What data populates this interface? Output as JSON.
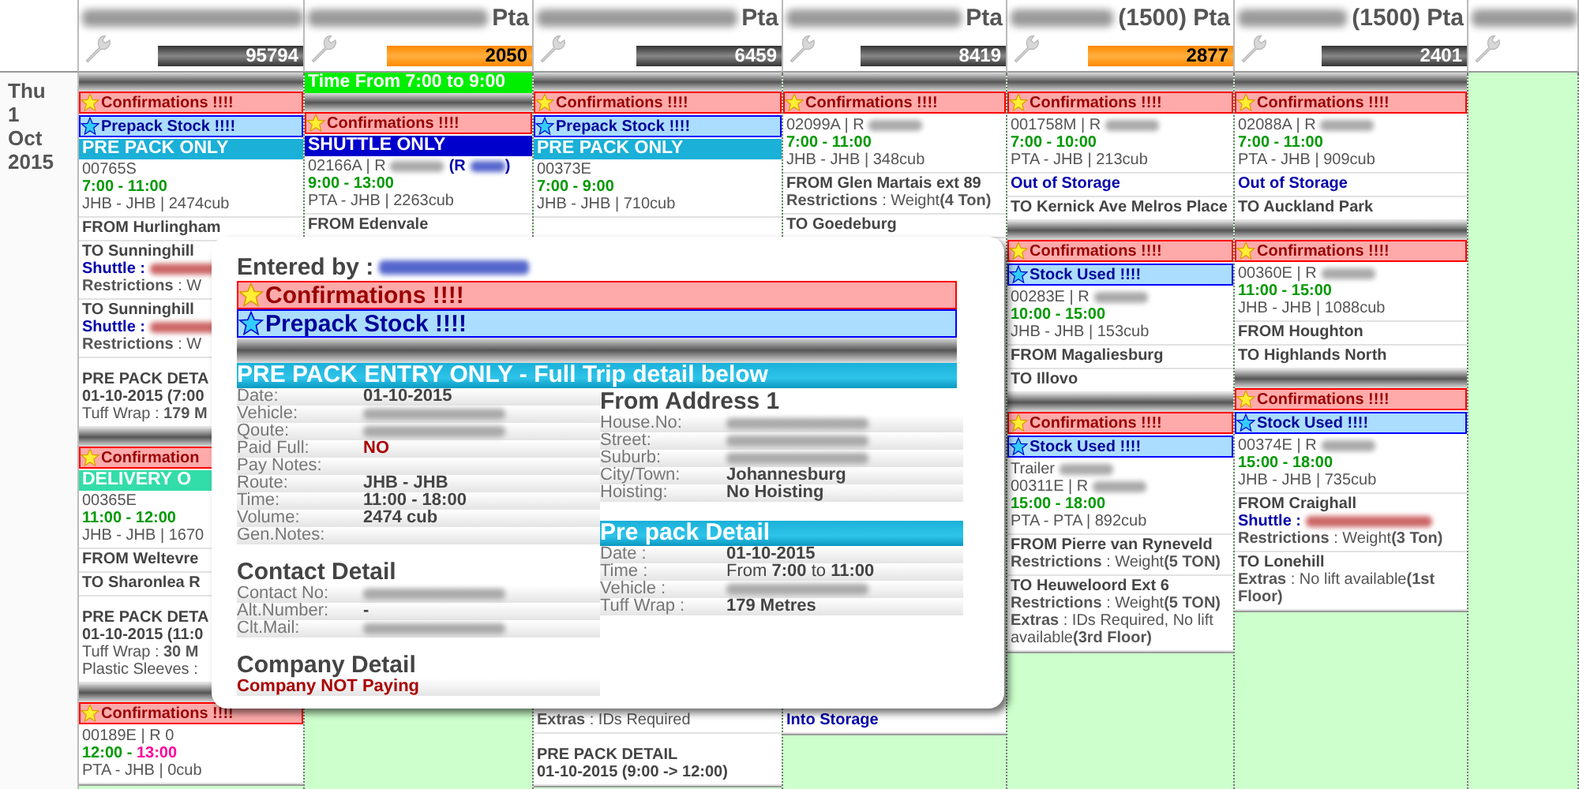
{
  "date": {
    "weekday": "Thu",
    "day": "1",
    "month": "Oct",
    "year": "2015"
  },
  "columns": [
    {
      "header": {
        "count": "95794",
        "highlight": false
      },
      "items": [
        {
          "kind": "redacted"
        },
        {
          "kind": "confirm",
          "text": "Confirmations !!!!"
        },
        {
          "kind": "stock",
          "text": "Prepack Stock !!!!"
        },
        {
          "kind": "band",
          "text": "PRE PACK ONLY",
          "color": "#1ab0d8"
        },
        {
          "kind": "section",
          "lines": [
            {
              "kind": "plain",
              "text": "00765S"
            },
            {
              "kind": "time",
              "text": "7:00 - 11:00"
            },
            {
              "kind": "plain",
              "text": "JHB - JHB | 2474cub"
            }
          ]
        },
        {
          "kind": "section",
          "lines": [
            {
              "kind": "place",
              "text": "FROM Hurlingham"
            }
          ]
        },
        {
          "kind": "section",
          "lines": [
            {
              "kind": "place",
              "text": "TO Sunninghill"
            },
            {
              "kind": "shuttle",
              "text": "Shuttle :"
            },
            {
              "kind": "detail",
              "text": "**Restrictions** : W"
            }
          ]
        },
        {
          "kind": "section",
          "lines": [
            {
              "kind": "place",
              "text": "TO Sunninghill"
            },
            {
              "kind": "shuttle",
              "text": "Shuttle :"
            },
            {
              "kind": "detail",
              "text": "**Restrictions** : W"
            }
          ]
        },
        {
          "kind": "section",
          "lines": [
            {
              "kind": "heading",
              "text": "PRE PACK DETA"
            },
            {
              "kind": "place",
              "text": "01-10-2015 (7:00"
            },
            {
              "kind": "detail",
              "text": "Tuff Wrap : **179 M**"
            }
          ]
        },
        {
          "kind": "redacted"
        },
        {
          "kind": "confirm",
          "text": "Confirmation"
        },
        {
          "kind": "band",
          "text": "DELIVERY O",
          "color": "#33ddaa"
        },
        {
          "kind": "section",
          "lines": [
            {
              "kind": "plain",
              "text": "00365E"
            },
            {
              "kind": "time",
              "text": "11:00 - 12:00"
            },
            {
              "kind": "plain",
              "text": "JHB - JHB | 1670"
            }
          ]
        },
        {
          "kind": "section",
          "lines": [
            {
              "kind": "place",
              "text": "FROM Weltevre"
            }
          ]
        },
        {
          "kind": "section",
          "lines": [
            {
              "kind": "place",
              "text": "TO Sharonlea R"
            }
          ]
        },
        {
          "kind": "section",
          "lines": [
            {
              "kind": "heading",
              "text": "PRE PACK DETA"
            },
            {
              "kind": "place",
              "text": "01-10-2015 (11:0"
            },
            {
              "kind": "detail",
              "text": "Tuff Wrap : **30 M**"
            },
            {
              "kind": "plain",
              "text": "Plastic Sleeves :"
            }
          ]
        },
        {
          "kind": "redacted"
        },
        {
          "kind": "confirm",
          "text": "Confirmations !!!!"
        },
        {
          "kind": "section",
          "lines": [
            {
              "kind": "plain",
              "text": "00189E | R 0"
            },
            {
              "kind": "time",
              "text": "12:00 - ",
              "late": "13:00"
            },
            {
              "kind": "plain",
              "text": "PTA - JHB | 0cub"
            }
          ]
        }
      ]
    },
    {
      "header": {
        "suffix": "Pta",
        "count": "2050",
        "highlight": true
      },
      "items": [
        {
          "kind": "band",
          "text": "Time From 7:00 to 9:00",
          "color": "#00ee00"
        },
        {
          "kind": "redacted"
        },
        {
          "kind": "confirm",
          "text": "Confirmations !!!!"
        },
        {
          "kind": "band",
          "text": "SHUTTLE ONLY",
          "color": "#0000cc"
        },
        {
          "kind": "section",
          "lines": [
            {
              "kind": "plain",
              "text": "02166A | R",
              "redacted": true,
              "extra": "(R",
              "tail": ")"
            },
            {
              "kind": "time",
              "text": "9:00 - 13:00"
            },
            {
              "kind": "plain",
              "text": "PTA - JHB | 2263cub"
            }
          ]
        },
        {
          "kind": "section",
          "lines": [
            {
              "kind": "place",
              "text": "FROM Edenvale"
            }
          ]
        }
      ]
    },
    {
      "header": {
        "suffix": "Pta",
        "count": "6459",
        "highlight": false
      },
      "items": [
        {
          "kind": "redacted"
        },
        {
          "kind": "confirm",
          "text": "Confirmations !!!!"
        },
        {
          "kind": "stock",
          "text": "Prepack Stock !!!!"
        },
        {
          "kind": "band",
          "text": "PRE PACK ONLY",
          "color": "#1ab0d8"
        },
        {
          "kind": "section",
          "lines": [
            {
              "kind": "plain",
              "text": "00373E"
            },
            {
              "kind": "time",
              "text": "7:00 - 9:00"
            },
            {
              "kind": "plain",
              "text": "JHB - JHB | 710cub"
            }
          ]
        }
      ],
      "below": [
        {
          "kind": "section",
          "lines": [
            {
              "kind": "detail",
              "text": "**Extras** : IDs Required"
            }
          ]
        },
        {
          "kind": "section",
          "lines": [
            {
              "kind": "heading",
              "text": "PRE PACK DETAIL"
            },
            {
              "kind": "place",
              "text": "01-10-2015 (9:00 -> 12:00)"
            }
          ]
        }
      ]
    },
    {
      "header": {
        "suffix": "Pta",
        "count": "8419",
        "highlight": false
      },
      "items": [
        {
          "kind": "redacted"
        },
        {
          "kind": "confirm",
          "text": "Confirmations !!!!"
        },
        {
          "kind": "section",
          "lines": [
            {
              "kind": "plain",
              "text": "02099A | R",
              "redacted": true
            },
            {
              "kind": "time",
              "text": "7:00 - 11:00"
            },
            {
              "kind": "plain",
              "text": "JHB - JHB | 348cub"
            }
          ]
        },
        {
          "kind": "section",
          "lines": [
            {
              "kind": "place",
              "text": "FROM Glen Martais ext 89"
            },
            {
              "kind": "detail",
              "text": "**Restrictions** : Weight**(4 Ton)**"
            }
          ]
        },
        {
          "kind": "section",
          "lines": [
            {
              "kind": "place",
              "text": "TO Goedeburg"
            }
          ]
        }
      ],
      "below": [
        {
          "kind": "section",
          "lines": [
            {
              "kind": "storage",
              "text": "Into Storage"
            }
          ]
        }
      ]
    },
    {
      "header": {
        "suffix": "(1500) Pta",
        "count": "2877",
        "highlight": true
      },
      "items": [
        {
          "kind": "redacted"
        },
        {
          "kind": "confirm",
          "text": "Confirmations !!!!"
        },
        {
          "kind": "section",
          "lines": [
            {
              "kind": "plain",
              "text": "001758M | R",
              "redacted": true
            },
            {
              "kind": "time",
              "text": "7:00 - 10:00"
            },
            {
              "kind": "plain",
              "text": "PTA - JHB | 213cub"
            }
          ]
        },
        {
          "kind": "section",
          "lines": [
            {
              "kind": "storage",
              "text": "Out of Storage"
            }
          ]
        },
        {
          "kind": "section",
          "lines": [
            {
              "kind": "place",
              "text": "TO Kernick Ave Melros Place"
            }
          ]
        },
        {
          "kind": "redacted"
        },
        {
          "kind": "confirm",
          "text": "Confirmations !!!!"
        },
        {
          "kind": "stock",
          "text": "Stock Used !!!!"
        },
        {
          "kind": "section",
          "lines": [
            {
              "kind": "plain",
              "text": "00283E | R",
              "redacted": true
            },
            {
              "kind": "time",
              "text": "10:00 - 15:00"
            },
            {
              "kind": "plain",
              "text": "JHB - JHB | 153cub"
            }
          ]
        },
        {
          "kind": "section",
          "lines": [
            {
              "kind": "place",
              "text": "FROM Magaliesburg"
            }
          ]
        },
        {
          "kind": "section",
          "lines": [
            {
              "kind": "place",
              "text": "TO Illovo"
            }
          ]
        },
        {
          "kind": "redacted"
        },
        {
          "kind": "confirm",
          "text": "Confirmations !!!!"
        },
        {
          "kind": "stock",
          "text": "Stock Used !!!!"
        },
        {
          "kind": "section",
          "lines": [
            {
              "kind": "plain",
              "text": "Trailer",
              "redacted": true
            },
            {
              "kind": "plain",
              "text": "00311E | R",
              "redacted": true
            },
            {
              "kind": "time",
              "text": "15:00 - 18:00"
            },
            {
              "kind": "plain",
              "text": "PTA - PTA | 892cub"
            }
          ]
        },
        {
          "kind": "section",
          "lines": [
            {
              "kind": "place",
              "text": "FROM Pierre van Ryneveld"
            },
            {
              "kind": "detail",
              "text": "**Restrictions** : Weight**(5 TON)**"
            }
          ]
        },
        {
          "kind": "section",
          "lines": [
            {
              "kind": "place",
              "text": "TO Heuweloord Ext 6"
            },
            {
              "kind": "detail",
              "text": "**Restrictions** : Weight**(5 TON)**"
            },
            {
              "kind": "detail",
              "text": "**Extras** : IDs Required, No lift available**(3rd Floor)**"
            }
          ]
        }
      ]
    },
    {
      "header": {
        "suffix": "(1500) Pta",
        "count": "2401",
        "highlight": false
      },
      "items": [
        {
          "kind": "redacted"
        },
        {
          "kind": "confirm",
          "text": "Confirmations !!!!"
        },
        {
          "kind": "section",
          "lines": [
            {
              "kind": "plain",
              "text": "02088A | R",
              "redacted": true
            },
            {
              "kind": "time",
              "text": "7:00 - 11:00"
            },
            {
              "kind": "plain",
              "text": "PTA - JHB | 909cub"
            }
          ]
        },
        {
          "kind": "section",
          "lines": [
            {
              "kind": "storage",
              "text": "Out of Storage"
            }
          ]
        },
        {
          "kind": "section",
          "lines": [
            {
              "kind": "place",
              "text": "TO Auckland Park"
            }
          ]
        },
        {
          "kind": "redacted"
        },
        {
          "kind": "confirm",
          "text": "Confirmations !!!!"
        },
        {
          "kind": "section",
          "lines": [
            {
              "kind": "plain",
              "text": "00360E | R",
              "redacted": true
            },
            {
              "kind": "time",
              "text": "11:00 - 15:00"
            },
            {
              "kind": "plain",
              "text": "JHB - JHB | 1088cub"
            }
          ]
        },
        {
          "kind": "section",
          "lines": [
            {
              "kind": "place",
              "text": "FROM Houghton"
            }
          ]
        },
        {
          "kind": "section",
          "lines": [
            {
              "kind": "place",
              "text": "TO Highlands North"
            }
          ]
        },
        {
          "kind": "redacted"
        },
        {
          "kind": "confirm",
          "text": "Confirmations !!!!"
        },
        {
          "kind": "stock",
          "text": "Stock Used !!!!"
        },
        {
          "kind": "section",
          "lines": [
            {
              "kind": "plain",
              "text": "00374E | R",
              "redacted": true
            },
            {
              "kind": "time",
              "text": "15:00 - 18:00"
            },
            {
              "kind": "plain",
              "text": "JHB - JHB | 735cub"
            }
          ]
        },
        {
          "kind": "section",
          "lines": [
            {
              "kind": "place",
              "text": "FROM Craighall"
            },
            {
              "kind": "shuttle",
              "text": "Shuttle :"
            },
            {
              "kind": "detail",
              "text": "**Restrictions** : Weight**(3 Ton)**"
            }
          ]
        },
        {
          "kind": "section",
          "lines": [
            {
              "kind": "place",
              "text": "TO Lonehill"
            },
            {
              "kind": "detail",
              "text": "**Extras** : No lift available**(1st Floor)**"
            }
          ]
        }
      ]
    }
  ],
  "popup": {
    "entered_by": "Entered by :",
    "alerts": [
      {
        "kind": "confirm",
        "text": "Confirmations !!!!"
      },
      {
        "kind": "stock",
        "text": "Prepack Stock !!!!"
      }
    ],
    "band": "PRE PACK ENTRY ONLY - Full Trip detail below",
    "trip_fields": [
      {
        "label": "Date:",
        "value": "01-10-2015"
      },
      {
        "label": "Vehicle:",
        "redacted": true
      },
      {
        "label": "Qoute:",
        "redacted": true
      },
      {
        "label": "Paid Full:",
        "value": "NO",
        "alert": true
      },
      {
        "label": "Pay Notes:"
      },
      {
        "label": "Route:",
        "value": "JHB - JHB"
      },
      {
        "label": "Time:",
        "value": "11:00 - 18:00"
      },
      {
        "label": "Volume:",
        "value": "2474 cub"
      },
      {
        "label": "Gen.Notes:"
      }
    ],
    "contact_title": "Contact Detail",
    "contact_fields": [
      {
        "label": "Contact No:",
        "redacted": true
      },
      {
        "label": "Alt.Number:",
        "value": "-"
      },
      {
        "label": "Clt.Mail:",
        "redacted": true
      }
    ],
    "company_title": "Company Detail",
    "company": {
      "text": "Company NOT Paying",
      "alert": true
    },
    "address_title": "From Address 1",
    "address_fields": [
      {
        "label": "House.No:",
        "redacted": true
      },
      {
        "label": "Street:",
        "redacted": true
      },
      {
        "label": "Suburb:",
        "redacted": true
      },
      {
        "label": "City/Town:",
        "value": "Johannesburg"
      },
      {
        "label": "Hoisting:",
        "value": "No Hoisting"
      }
    ],
    "prepack_title": "Pre pack Detail",
    "prepack_fields": [
      {
        "label": "Date :",
        "value": "01-10-2015"
      },
      {
        "label": "Time :",
        "value": "From **7:00** to **11:00**",
        "mixed": true
      },
      {
        "label": "Vehicle :",
        "redacted": true
      },
      {
        "label": "Tuff Wrap :",
        "value": "179 Metres"
      }
    ]
  }
}
